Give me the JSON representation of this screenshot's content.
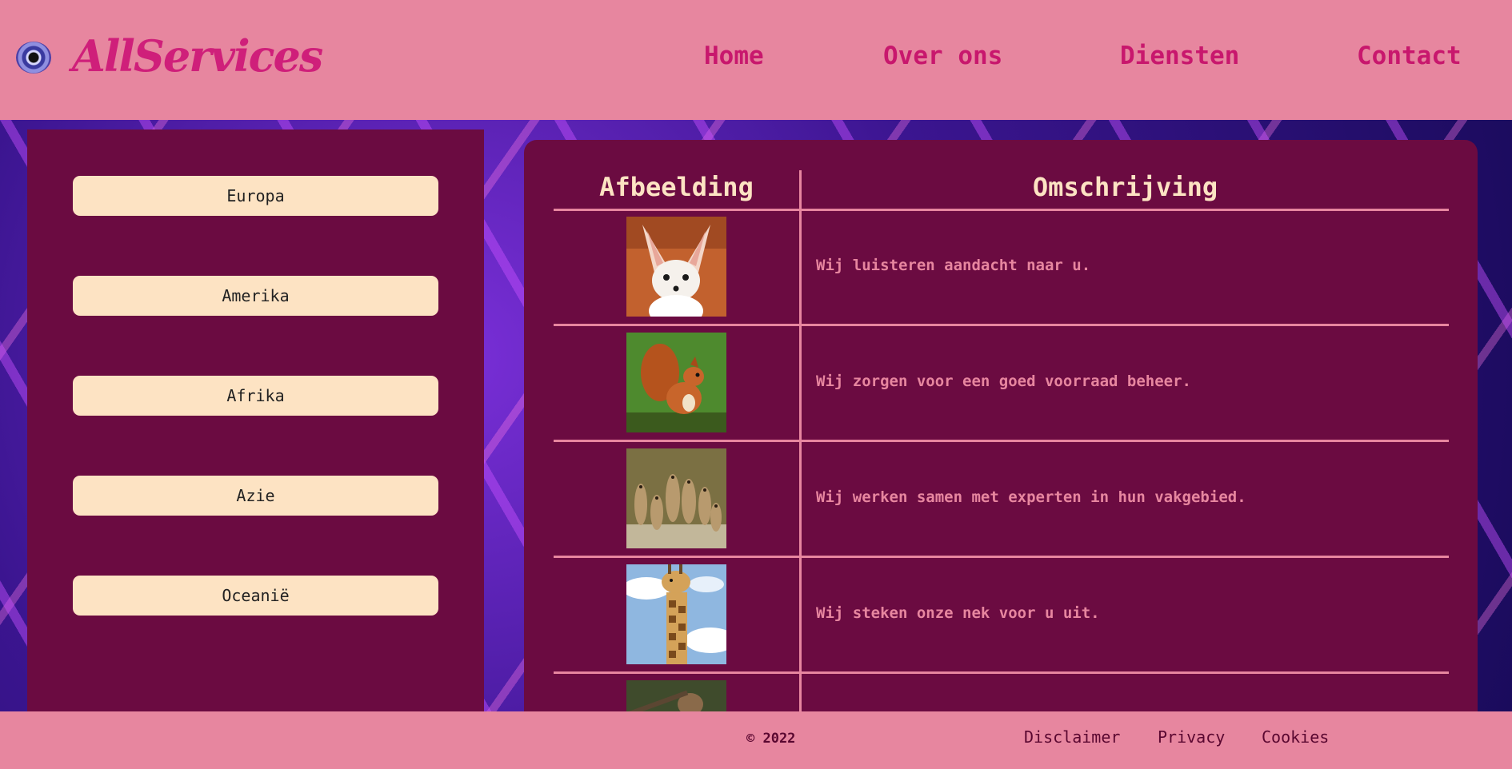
{
  "brand": {
    "name": "AllServices"
  },
  "nav": {
    "items": [
      {
        "label": "Home"
      },
      {
        "label": "Over ons"
      },
      {
        "label": "Diensten"
      },
      {
        "label": "Contact"
      }
    ]
  },
  "sidebar": {
    "regions": [
      {
        "label": "Europa"
      },
      {
        "label": "Amerika"
      },
      {
        "label": "Afrika"
      },
      {
        "label": "Azie"
      },
      {
        "label": "Oceanië"
      }
    ]
  },
  "table": {
    "headers": {
      "image": "Afbeelding",
      "description": "Omschrijving"
    },
    "rows": [
      {
        "image": "fennec-fox-photo",
        "description": "Wij luisteren aandacht naar u."
      },
      {
        "image": "squirrel-photo",
        "description": "Wij zorgen voor een goed voorraad beheer."
      },
      {
        "image": "meerkats-photo",
        "description": "Wij werken samen met experten in hun vakgebied."
      },
      {
        "image": "giraffe-photo",
        "description": "Wij steken onze nek voor u uit."
      },
      {
        "image": "monkey-photo",
        "description": ""
      }
    ]
  },
  "footer": {
    "copyright": "© 2022",
    "links": [
      {
        "label": "Disclaimer"
      },
      {
        "label": "Privacy"
      },
      {
        "label": "Cookies"
      }
    ]
  },
  "colors": {
    "header_bg": "#e7869f",
    "panel_bg": "#6b0b41",
    "button_bg": "#fde3c3",
    "accent": "#c8176d"
  }
}
